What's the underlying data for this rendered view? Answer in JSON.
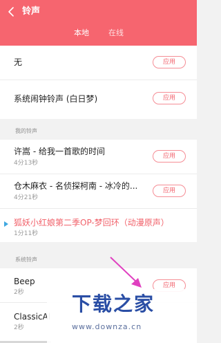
{
  "header": {
    "title": "铃声",
    "tabs": [
      {
        "label": "本地",
        "active": true
      },
      {
        "label": "在线",
        "active": false
      }
    ],
    "background_color": "#f6656f"
  },
  "apply_label": "应用",
  "top_items": [
    {
      "title": "无"
    },
    {
      "title": "系统闹钟铃声 (白日梦)"
    }
  ],
  "my_ringtones": {
    "section_label": "我的铃声",
    "items": [
      {
        "title": "许嵩 - 给我一首歌的时间",
        "duration": "4分13秒"
      },
      {
        "title": "仓木麻衣 - 名侦探柯南 - 冰冷的...",
        "duration": "4分21秒"
      },
      {
        "title": "狐妖小红娘第二季OP-梦回环（动漫原声）",
        "duration": "1分11秒",
        "playing": true
      }
    ]
  },
  "system_ringtones": {
    "section_label": "系统铃声",
    "items": [
      {
        "title": "Beep",
        "duration": "2秒"
      },
      {
        "title": "ClassicAl",
        "duration": "2秒"
      }
    ]
  },
  "watermark": {
    "logo_text": "下载之家",
    "url": "www.downza.cn"
  },
  "accent_color": "#f1616a"
}
